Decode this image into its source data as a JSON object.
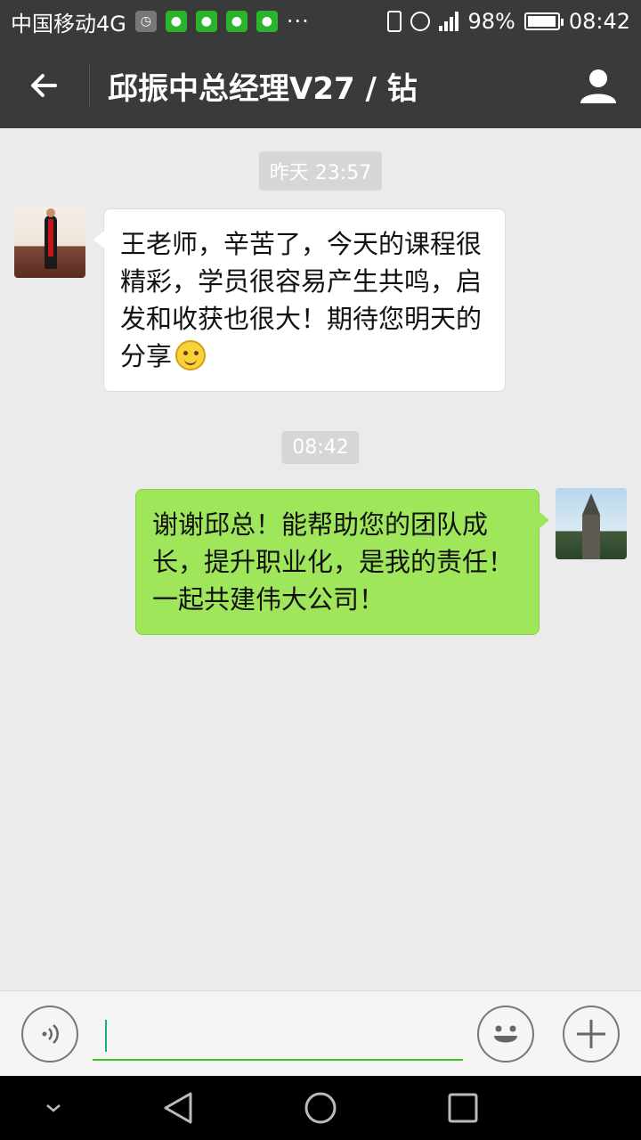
{
  "status_bar": {
    "carrier": "中国移动4G",
    "more": "···",
    "battery": "98%",
    "time": "08:42",
    "battery_level": 0.98
  },
  "header": {
    "title": "邱振中总经理V27 / 钻"
  },
  "messages": [
    {
      "timestamp": "昨天 23:57",
      "side": "left",
      "text": "王老师，辛苦了，今天的课程很精彩，学员很容易产生共鸣，启发和收获也很大！期待您明天的分享"
    },
    {
      "timestamp": "08:42",
      "side": "right",
      "text": "谢谢邱总！能帮助您的团队成长，提升职业化，是我的责任！一起共建伟大公司！"
    }
  ],
  "input": {
    "value": "",
    "plus_label": "+"
  },
  "colors": {
    "header_bg": "#3a3a3a",
    "chat_bg": "#ebebeb",
    "sent_bubble": "#9fe65a",
    "received_bubble": "#ffffff",
    "accent": "#45c01a"
  },
  "icons": [
    "back-arrow-icon",
    "profile-icon",
    "voice-icon",
    "emoji-icon",
    "plus-icon",
    "nav-back-icon",
    "nav-home-icon",
    "nav-recent-icon",
    "nav-collapse-icon"
  ]
}
